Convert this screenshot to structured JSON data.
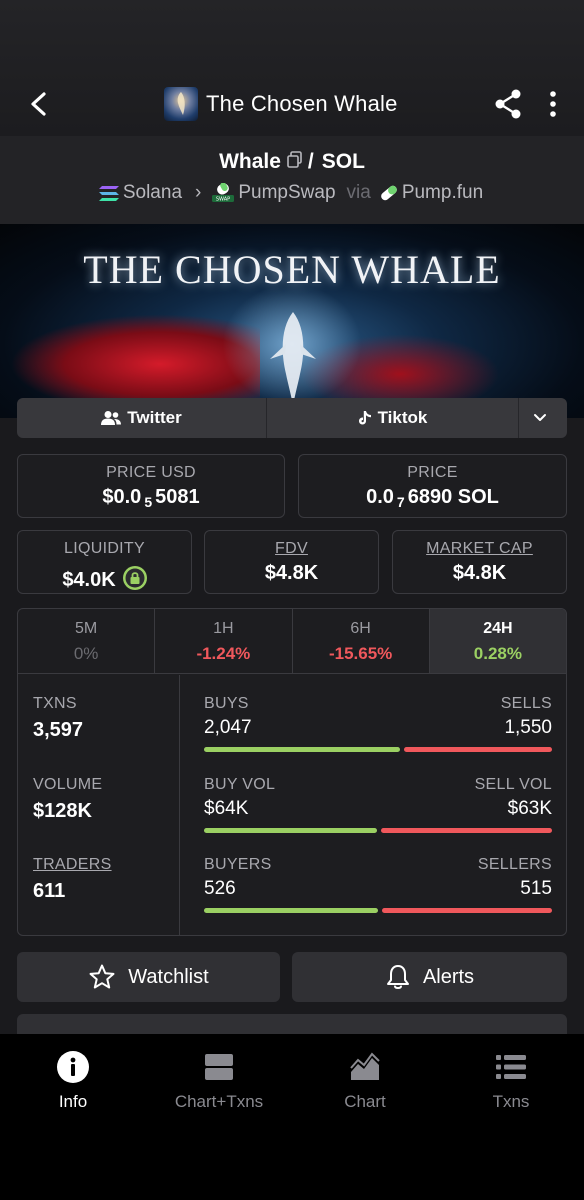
{
  "header": {
    "title": "The Chosen Whale"
  },
  "pair": {
    "base": "Whale",
    "separator": "/",
    "quote": "SOL",
    "chain": "Solana",
    "dex": "PumpSwap",
    "via_label": "via",
    "launchpad": "Pump.fun"
  },
  "banner": {
    "title": "THE CHOSEN WHALE"
  },
  "socials": {
    "twitter": "Twitter",
    "tiktok": "Tiktok"
  },
  "prices": {
    "usd_label": "PRICE USD",
    "usd_prefix": "$0.0",
    "usd_zeros": "5",
    "usd_digits": "5081",
    "native_label": "PRICE",
    "native_prefix": "0.0",
    "native_zeros": "7",
    "native_digits": "6890 SOL"
  },
  "metrics": {
    "liquidity_label": "LIQUIDITY",
    "liquidity_value": "$4.0K",
    "fdv_label": "FDV",
    "fdv_value": "$4.8K",
    "mcap_label": "MARKET CAP",
    "mcap_value": "$4.8K"
  },
  "timeframes": [
    {
      "label": "5M",
      "change": "0%"
    },
    {
      "label": "1H",
      "change": "-1.24%"
    },
    {
      "label": "6H",
      "change": "-15.65%"
    },
    {
      "label": "24H",
      "change": "0.28%"
    }
  ],
  "stats": {
    "txns_label": "TXNS",
    "txns_value": "3,597",
    "volume_label": "VOLUME",
    "volume_value": "$128K",
    "traders_label": "TRADERS",
    "traders_value": "611",
    "buys_label": "BUYS",
    "buys_value": "2,047",
    "sells_label": "SELLS",
    "sells_value": "1,550",
    "buys_fraction": 0.569,
    "buyvol_label": "BUY VOL",
    "buyvol_value": "$64K",
    "sellvol_label": "SELL VOL",
    "sellvol_value": "$63K",
    "buyvol_fraction": 0.504,
    "buyers_label": "BUYERS",
    "buyers_value": "526",
    "sellers_label": "SELLERS",
    "sellers_value": "515",
    "buyers_fraction": 0.505
  },
  "actions": {
    "watchlist": "Watchlist",
    "alerts": "Alerts"
  },
  "nav": [
    {
      "label": "Info",
      "icon": "info-icon"
    },
    {
      "label": "Chart+Txns",
      "icon": "split-view-icon"
    },
    {
      "label": "Chart",
      "icon": "chart-icon"
    },
    {
      "label": "Txns",
      "icon": "list-icon"
    }
  ],
  "colors": {
    "positive": "#9bd063",
    "negative": "#f0585c",
    "background": "#1a1a1d"
  }
}
